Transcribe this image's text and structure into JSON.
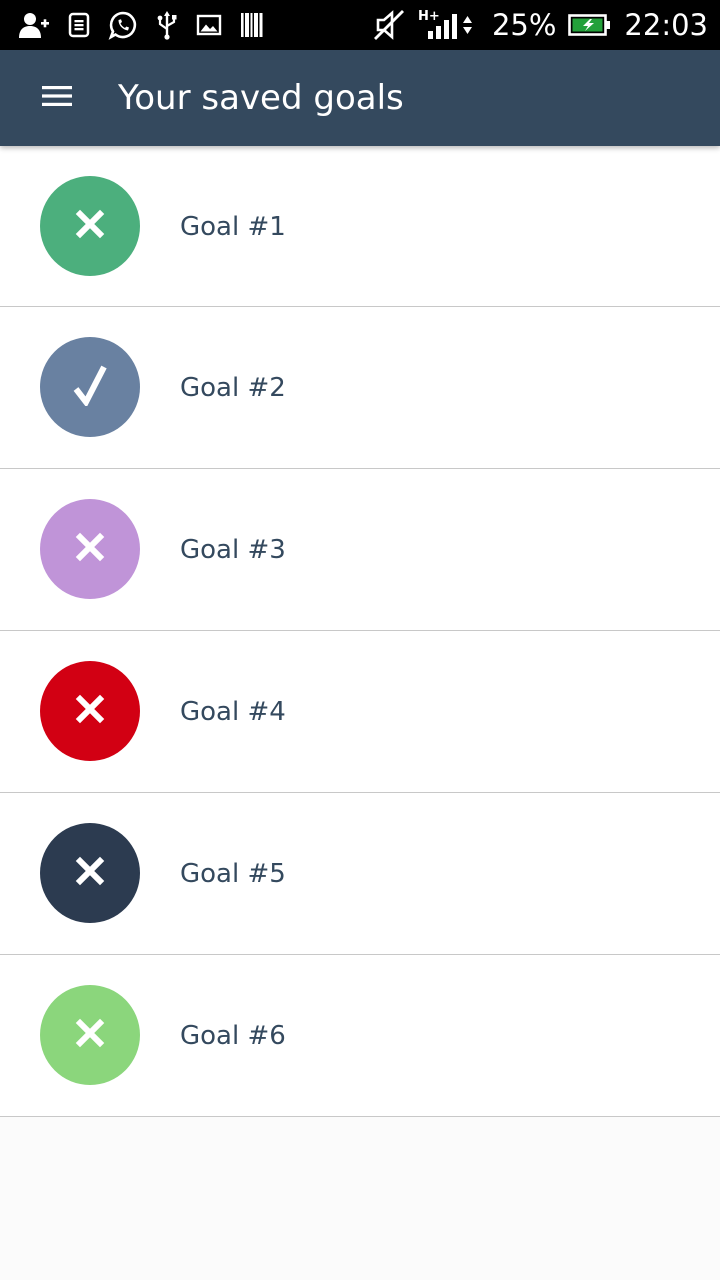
{
  "status_bar": {
    "icons_left": [
      "add-contact-icon",
      "sim-card-icon",
      "whatsapp-icon",
      "usb-icon",
      "image-icon",
      "barcode-icon"
    ],
    "icons_right": [
      "mute-icon",
      "signal-icon",
      "battery-icon"
    ],
    "network_type": "H+",
    "battery_percent": "25%",
    "time": "22:03"
  },
  "app_bar": {
    "menu_icon": "hamburger-menu-icon",
    "title": "Your saved goals",
    "background_color": "#34495e"
  },
  "goals": [
    {
      "label": "Goal #1",
      "status": "incomplete",
      "icon": "close-icon",
      "color": "#4caf7d"
    },
    {
      "label": "Goal #2",
      "status": "complete",
      "icon": "check-icon",
      "color": "#6981a1"
    },
    {
      "label": "Goal #3",
      "status": "incomplete",
      "icon": "close-icon",
      "color": "#c094d8"
    },
    {
      "label": "Goal #4",
      "status": "incomplete",
      "icon": "close-icon",
      "color": "#d20013"
    },
    {
      "label": "Goal #5",
      "status": "incomplete",
      "icon": "close-icon",
      "color": "#2c3b50"
    },
    {
      "label": "Goal #6",
      "status": "incomplete",
      "icon": "close-icon",
      "color": "#8bd67c"
    }
  ]
}
